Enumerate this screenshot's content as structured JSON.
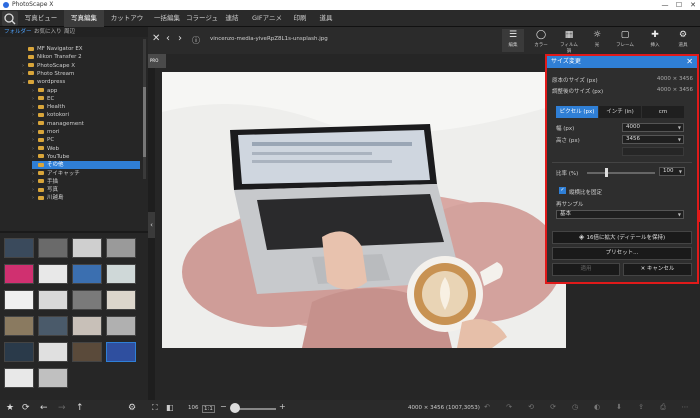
{
  "window": {
    "title": "PhotoScape X",
    "minimize": "—",
    "maximize": "☐",
    "close": "✕"
  },
  "menu": {
    "tabs": [
      "写真ビューアー",
      "写真編集",
      "カットアウト",
      "一括編集",
      "コラージュ",
      "連結",
      "GIFアニメ",
      "印刷",
      "道具"
    ],
    "active_index": 1
  },
  "sidebar": {
    "tabs": [
      "フォルダー",
      "お気に入り",
      "周辺"
    ],
    "active_tab": 0,
    "tree": [
      {
        "label": "MF Navigator EX",
        "level": 1,
        "arrow": ""
      },
      {
        "label": "Nikon Transfer 2",
        "level": 1,
        "arrow": ""
      },
      {
        "label": "PhotoScape X",
        "level": 1,
        "arrow": "›"
      },
      {
        "label": "Photo Stream",
        "level": 1,
        "arrow": "›"
      },
      {
        "label": "wordpress",
        "level": 1,
        "arrow": "⌄"
      },
      {
        "label": "app",
        "level": 2,
        "arrow": "›"
      },
      {
        "label": "EC",
        "level": 2,
        "arrow": "›"
      },
      {
        "label": "Health",
        "level": 2,
        "arrow": "›"
      },
      {
        "label": "kotokori",
        "level": 2,
        "arrow": "›"
      },
      {
        "label": "management",
        "level": 2,
        "arrow": "›"
      },
      {
        "label": "mori",
        "level": 2,
        "arrow": "›"
      },
      {
        "label": "PC",
        "level": 2,
        "arrow": "›"
      },
      {
        "label": "Web",
        "level": 2,
        "arrow": "›"
      },
      {
        "label": "YouTube",
        "level": 2,
        "arrow": "›"
      },
      {
        "label": "その他",
        "level": 2,
        "arrow": "",
        "selected": true
      },
      {
        "label": "アイキャッチ",
        "level": 2,
        "arrow": "›"
      },
      {
        "label": "手描",
        "level": 2,
        "arrow": "›"
      },
      {
        "label": "写真",
        "level": 2,
        "arrow": "›"
      },
      {
        "label": "川越島",
        "level": 2,
        "arrow": "›"
      }
    ]
  },
  "toolbar": {
    "filepath": "vincenzo-media-yiveRpZ8L1s-unsplash.jpg",
    "tools": [
      {
        "label": "編集",
        "icon": "sliders-icon"
      },
      {
        "label": "カラー",
        "icon": "color-circle-icon"
      },
      {
        "label": "フィルム調",
        "icon": "film-icon"
      },
      {
        "label": "光",
        "icon": "sun-icon"
      },
      {
        "label": "フレーム",
        "icon": "frame-icon"
      },
      {
        "label": "挿入",
        "icon": "insert-icon"
      },
      {
        "label": "道具",
        "icon": "tools-icon"
      }
    ]
  },
  "badge": {
    "label": "PRO"
  },
  "dialog": {
    "title": "サイズ変更",
    "original_size_label": "原本のサイズ (px)",
    "original_size_value": "4000 × 3456",
    "adjusted_size_label": "調整後のサイズ (px)",
    "adjusted_size_value": "4000 × 3456",
    "unit_tabs": [
      "ピクセル (px)",
      "インチ (in)",
      "cm"
    ],
    "active_unit": 0,
    "width_label": "幅 (px)",
    "width_value": "4000",
    "height_label": "高さ (px)",
    "height_value": "3456",
    "ratio_label": "比率 (%)",
    "ratio_value": "100",
    "keep_ratio_label": "縦横比を固定",
    "resample_label": "再サンプル",
    "resample_value": "基本",
    "enlarge_button": "16倍に拡大 (ディテールを保持)",
    "preset_button": "プリセット...",
    "apply_button": "適用",
    "cancel_button": "キャンセル"
  },
  "status": {
    "zoom": "106",
    "ratio_box": "1:1",
    "dimensions": "4000 × 3456 (1007,3053)"
  },
  "colors": {
    "accent": "#2f7fd6",
    "highlight_border": "#e01a1a"
  }
}
